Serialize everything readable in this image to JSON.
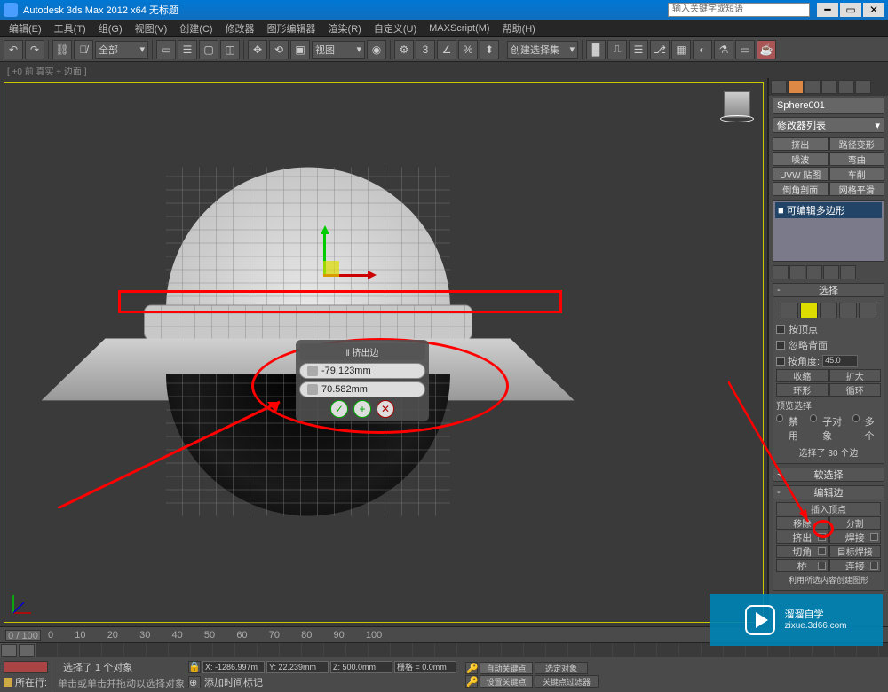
{
  "title": "Autodesk 3ds Max 2012 x64   无标题",
  "searchPlaceholder": "输入关键字或短语",
  "menus": [
    "编辑(E)",
    "工具(T)",
    "组(G)",
    "视图(V)",
    "创建(C)",
    "修改器",
    "图形编辑器",
    "渲染(R)",
    "自定义(U)",
    "MAXScript(M)",
    "帮助(H)"
  ],
  "toolbar": {
    "dropdown1": "全部",
    "dropdown2": "视图",
    "dropdown3": "创建选择集"
  },
  "substatus": "[ +0 前 真实 + 边面 ]",
  "viewport": {
    "caddy": {
      "title": "‖ 挤出边",
      "val1": "-79.123mm",
      "val2": "70.582mm"
    }
  },
  "rpanel": {
    "objectName": "Sphere001",
    "modListLabel": "修改器列表",
    "modbtns": [
      "挤出",
      "路径变形",
      "噪波",
      "弯曲",
      "UVW 贴图",
      "车削",
      "倒角剖面",
      "网格平滑"
    ],
    "stackItem": "■ 可编辑多边形",
    "roll1": {
      "title": "选择",
      "byVertex": "按顶点",
      "ignoreBack": "忽略背面",
      "byAngle": "按角度:",
      "angle": "45.0",
      "shrink": "收缩",
      "grow": "扩大",
      "ring": "环形",
      "loop": "循环",
      "preview": "预览选择",
      "disable": "禁用",
      "sub": "子对象",
      "multi": "多个",
      "selinfo": "选择了 30 个边"
    },
    "roll2": {
      "title": "软选择"
    },
    "roll3": {
      "title": "编辑边",
      "insertV": "插入顶点",
      "remove": "移除",
      "split": "分割",
      "extrude": "挤出",
      "weld": "焊接",
      "chamfer": "切角",
      "targetWeld": "目标焊接",
      "bridge": "桥",
      "connect": "连接",
      "createShape": "利用所选内容创建图形"
    }
  },
  "timeline": {
    "slider": "0 / 100"
  },
  "status": {
    "selected": "选择了 1 个对象",
    "addTimeTag": "添加时间标记",
    "hint": "单击或单击并拖动以选择对象",
    "x": "X: -1286.997m",
    "y": "Y: 22.239mm",
    "z": "Z: 500.0mm",
    "grid": "栅格 = 0.0mm",
    "autokey": "自动关键点",
    "setkey": "设置关键点",
    "selectedSet": "选定对象",
    "keyfilter": "关键点过滤器",
    "nowLabel": "所在行:"
  },
  "watermark": {
    "main": "溜溜自学",
    "sub": "zixue.3d66.com"
  }
}
